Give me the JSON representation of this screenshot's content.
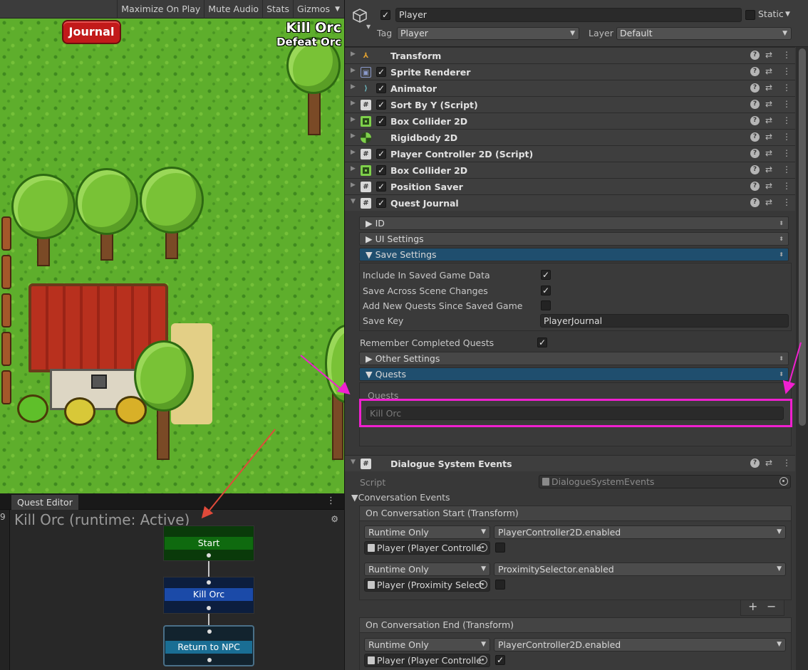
{
  "game_view": {
    "toolbar": [
      "Maximize On Play",
      "Mute Audio",
      "Stats",
      "Gizmos"
    ],
    "journal_button": "Journal",
    "hud_quest_title": "Kill Orc",
    "hud_quest_description": "Defeat Orc"
  },
  "quest_editor": {
    "tab": "Quest Editor",
    "side_number": "9",
    "title": "Kill Orc (runtime: Active)",
    "nodes": [
      {
        "label": "Start",
        "color": "#0f6a0f"
      },
      {
        "label": "Kill Orc",
        "color": "#1b4aa8"
      },
      {
        "label": "Return to NPC",
        "color": "#1a6e94"
      }
    ]
  },
  "inspector": {
    "object_name": "Player",
    "static_label": "Static",
    "tag_label": "Tag",
    "tag_value": "Player",
    "layer_label": "Layer",
    "layer_value": "Default",
    "components": [
      {
        "name": "Transform",
        "icon": "transform-icon"
      },
      {
        "name": "Sprite Renderer",
        "icon": "sprite-renderer-icon"
      },
      {
        "name": "Animator",
        "icon": "animator-icon"
      },
      {
        "name": "Sort By Y (Script)",
        "icon": "script-icon"
      },
      {
        "name": "Box Collider 2D",
        "icon": "box-collider-icon"
      },
      {
        "name": "Rigidbody 2D",
        "icon": "rigidbody-icon"
      },
      {
        "name": "Player Controller 2D (Script)",
        "icon": "script-icon"
      },
      {
        "name": "Box Collider 2D",
        "icon": "box-collider-icon"
      },
      {
        "name": "Position Saver",
        "icon": "script-icon"
      },
      {
        "name": "Quest Journal",
        "icon": "script-icon"
      }
    ],
    "quest_journal": {
      "foldouts": {
        "id": "ID",
        "ui_settings": "UI Settings",
        "save_settings": "Save Settings",
        "other_settings": "Other Settings",
        "quests": "Quests"
      },
      "save_settings": {
        "include_saved_game": "Include In Saved Game Data",
        "save_across_scenes": "Save Across Scene Changes",
        "add_new_quests": "Add New Quests Since Saved Game",
        "save_key_label": "Save Key",
        "save_key_value": "PlayerJournal"
      },
      "remember_completed": "Remember Completed Quests",
      "quests_list_label": "Quests",
      "quests_list": [
        "Kill Orc"
      ]
    },
    "dialogue_events": {
      "name": "Dialogue System Events",
      "script_label": "Script",
      "script_value": "DialogueSystemEvents",
      "conversation_events": "Conversation Events",
      "on_start": {
        "header": "On Conversation Start (Transform)",
        "entries": [
          {
            "mode": "Runtime Only",
            "function": "PlayerController2D.enabled",
            "object": "Player (Player Controlle"
          },
          {
            "mode": "Runtime Only",
            "function": "ProximitySelector.enabled",
            "object": "Player (Proximity Select"
          }
        ]
      },
      "on_end": {
        "header": "On Conversation End (Transform)",
        "entries": [
          {
            "mode": "Runtime Only",
            "function": "PlayerController2D.enabled",
            "object": "Player (Player Controlle"
          }
        ]
      },
      "add_button": "+",
      "remove_button": "−"
    }
  }
}
